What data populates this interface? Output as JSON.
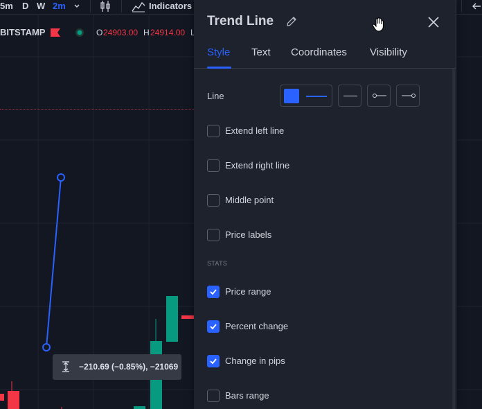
{
  "toolbar": {
    "interval_5m": "5m",
    "interval_d": "D",
    "interval_w": "W",
    "interval_2m": "2m",
    "indicators_label": "Indicators"
  },
  "symbol": {
    "exchange": "BITSTAMP",
    "open_label": "O",
    "open_value": "24903.00",
    "high_label": "H",
    "high_value": "24914.00",
    "low_label": "L"
  },
  "tooltip": {
    "text": "−210.69 (−0.85%), −21069"
  },
  "dialog": {
    "title": "Trend Line",
    "tabs": [
      "Style",
      "Text",
      "Coordinates",
      "Visibility"
    ],
    "active_tab": "Style",
    "line_label": "Line",
    "line_color": "#2962ff",
    "options": [
      {
        "label": "Extend left line",
        "checked": false
      },
      {
        "label": "Extend right line",
        "checked": false
      },
      {
        "label": "Middle point",
        "checked": false
      },
      {
        "label": "Price labels",
        "checked": false
      }
    ],
    "stats_heading": "STATS",
    "stats": [
      {
        "label": "Price range",
        "checked": true
      },
      {
        "label": "Percent change",
        "checked": true
      },
      {
        "label": "Change in pips",
        "checked": true
      },
      {
        "label": "Bars range",
        "checked": false
      }
    ]
  },
  "colors": {
    "accent": "#2962ff",
    "bull": "#089981",
    "bear": "#f23645",
    "background": "#131722",
    "dialog_bg": "#1e222d"
  }
}
